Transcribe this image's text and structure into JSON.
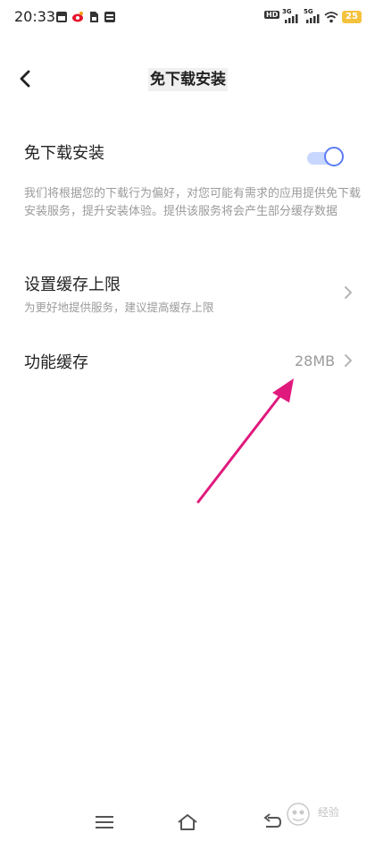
{
  "status_bar": {
    "time": "20:33",
    "hd_label": "HD",
    "sig1_label": "3G",
    "sig2_label": "5G",
    "battery": "25"
  },
  "header": {
    "title": "免下载安装",
    "back_icon": "chevron-left-icon"
  },
  "install_free": {
    "label": "免下载安装",
    "enabled": true,
    "description": "我们将根据您的下载行为偏好，对您可能有需求的应用提供免下载安装服务，提升安装体验。提供该服务将会产生部分缓存数据"
  },
  "cache_limit": {
    "label": "设置缓存上限",
    "sublabel": "为更好地提供服务，建议提高缓存上限"
  },
  "feature_cache": {
    "label": "功能缓存",
    "value": "28MB"
  },
  "colors": {
    "accent": "#5c7cf5",
    "annotation_arrow": "#e0197d"
  },
  "watermark": {
    "text": "经验"
  }
}
